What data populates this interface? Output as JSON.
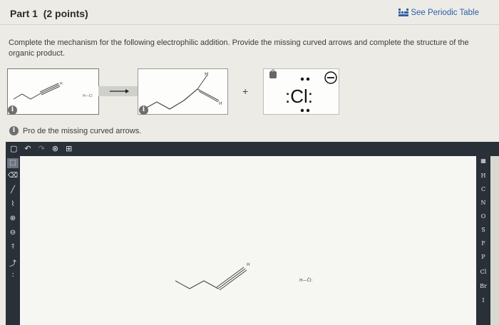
{
  "header": {
    "part_title": "Part 1",
    "points": "(2 points)",
    "periodic_table_link": "See Periodic Table"
  },
  "instructions": "Complete the mechanism for the following electrophilic addition. Provide the missing curved arrows and complete the structure of the organic product.",
  "reaction": {
    "reagent_hcl_label": "H—Cl",
    "product_h_top": "H",
    "product_h_side": "H",
    "alkyne_h": "H",
    "plus": "+",
    "chloride_symbol": ":Cl:",
    "chloride_charge": "−"
  },
  "badges": {
    "info_glyph": "i"
  },
  "prompt": "Pro   de the missing curved arrows.",
  "toolbar": {
    "items": [
      "new-doc-icon",
      "undo-icon",
      "redo-icon",
      "zoom-icon",
      "template-icon"
    ]
  },
  "left_tools": [
    "select-icon",
    "eraser-icon",
    "bond-icon",
    "chain-icon",
    "plus-charge-icon",
    "minus-charge-icon",
    "arrow-icon",
    "curved-arrow-icon",
    "lone-pair-icon"
  ],
  "elements": [
    "H",
    "C",
    "N",
    "O",
    "S",
    "F",
    "P",
    "Cl",
    "Br",
    "I"
  ],
  "canvas": {
    "alkyne_h": "H",
    "hcl_label": "H—C̈l:"
  },
  "colors": {
    "toolbar_bg": "#2a3038",
    "link": "#2f5fa3",
    "page_bg": "#ecebe6"
  }
}
